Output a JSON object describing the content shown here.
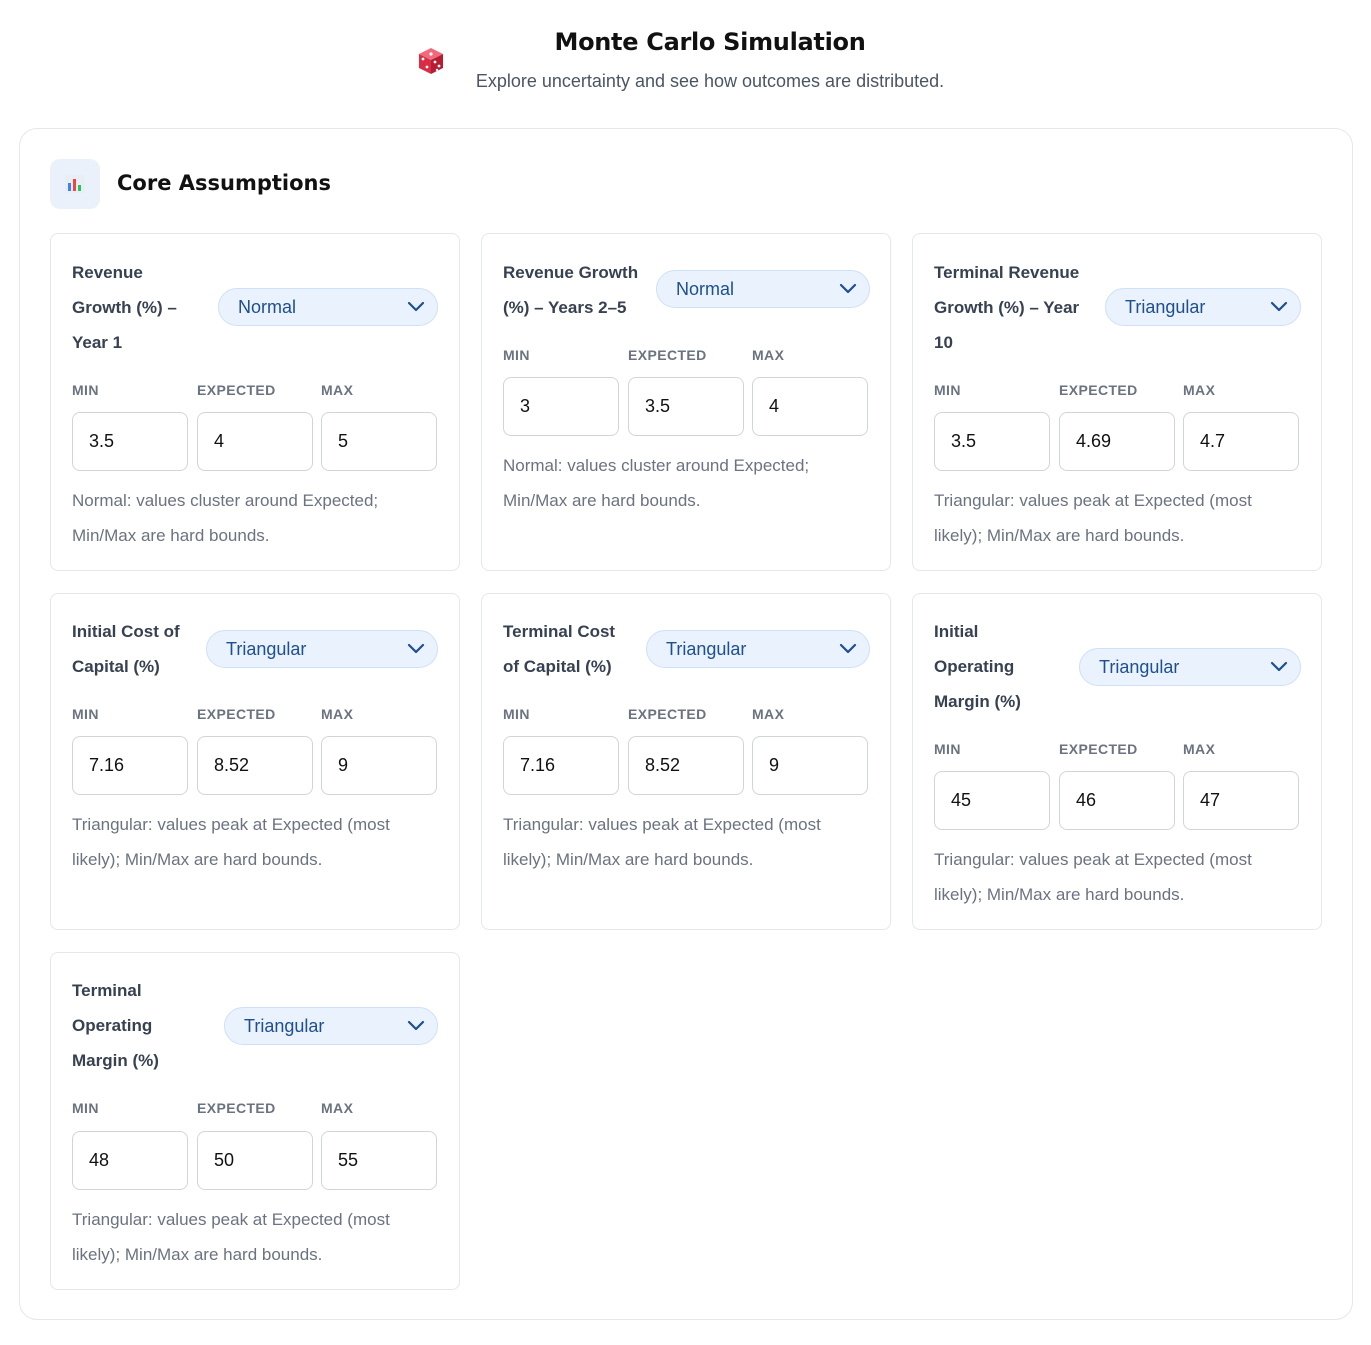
{
  "header": {
    "title": "Monte Carlo Simulation",
    "subtitle": "Explore uncertainty and see how outcomes are distributed.",
    "icon": "dice-icon"
  },
  "section": {
    "title": "Core Assumptions",
    "icon": "bar-chart-icon"
  },
  "field_labels": {
    "min": "MIN",
    "expected": "EXPECTED",
    "max": "MAX"
  },
  "cards": [
    {
      "label_lines": [
        "Revenue",
        "Growth (%) –",
        "Year 1"
      ],
      "distribution": "Normal",
      "min": "3.5",
      "expected": "4",
      "max": "5",
      "help_lines": [
        "Normal: values cluster around Expected;",
        "Min/Max are hard bounds."
      ]
    },
    {
      "label_lines": [
        "Revenue Growth",
        "(%) – Years 2–5"
      ],
      "distribution": "Normal",
      "min": "3",
      "expected": "3.5",
      "max": "4",
      "help_lines": [
        "Normal: values cluster around Expected;",
        "Min/Max are hard bounds."
      ]
    },
    {
      "label_lines": [
        "Terminal Revenue",
        "Growth (%) – Year",
        "10"
      ],
      "distribution": "Triangular",
      "min": "3.5",
      "expected": "4.69",
      "max": "4.7",
      "help_lines": [
        "Triangular: values peak at Expected (most",
        "likely); Min/Max are hard bounds."
      ]
    },
    {
      "label_lines": [
        "Initial Cost of",
        "Capital (%)"
      ],
      "distribution": "Triangular",
      "min": "7.16",
      "expected": "8.52",
      "max": "9",
      "help_lines": [
        "Triangular: values peak at Expected (most",
        "likely); Min/Max are hard bounds."
      ]
    },
    {
      "label_lines": [
        "Terminal Cost",
        "of Capital (%)"
      ],
      "distribution": "Triangular",
      "min": "7.16",
      "expected": "8.52",
      "max": "9",
      "help_lines": [
        "Triangular: values peak at Expected (most",
        "likely); Min/Max are hard bounds."
      ]
    },
    {
      "label_lines": [
        "Initial",
        "Operating",
        "Margin (%)"
      ],
      "distribution": "Triangular",
      "min": "45",
      "expected": "46",
      "max": "47",
      "help_lines": [
        "Triangular: values peak at Expected (most",
        "likely); Min/Max are hard bounds."
      ]
    },
    {
      "label_lines": [
        "Terminal",
        "Operating",
        "Margin (%)"
      ],
      "distribution": "Triangular",
      "min": "48",
      "expected": "50",
      "max": "55",
      "help_lines": [
        "Triangular: values peak at Expected (most",
        "likely); Min/Max are hard bounds."
      ]
    }
  ],
  "colors": {
    "accent": "#1d4f91",
    "select_bg": "#eaf2fd",
    "border": "#e5e7eb",
    "muted_text": "#6b7280"
  }
}
